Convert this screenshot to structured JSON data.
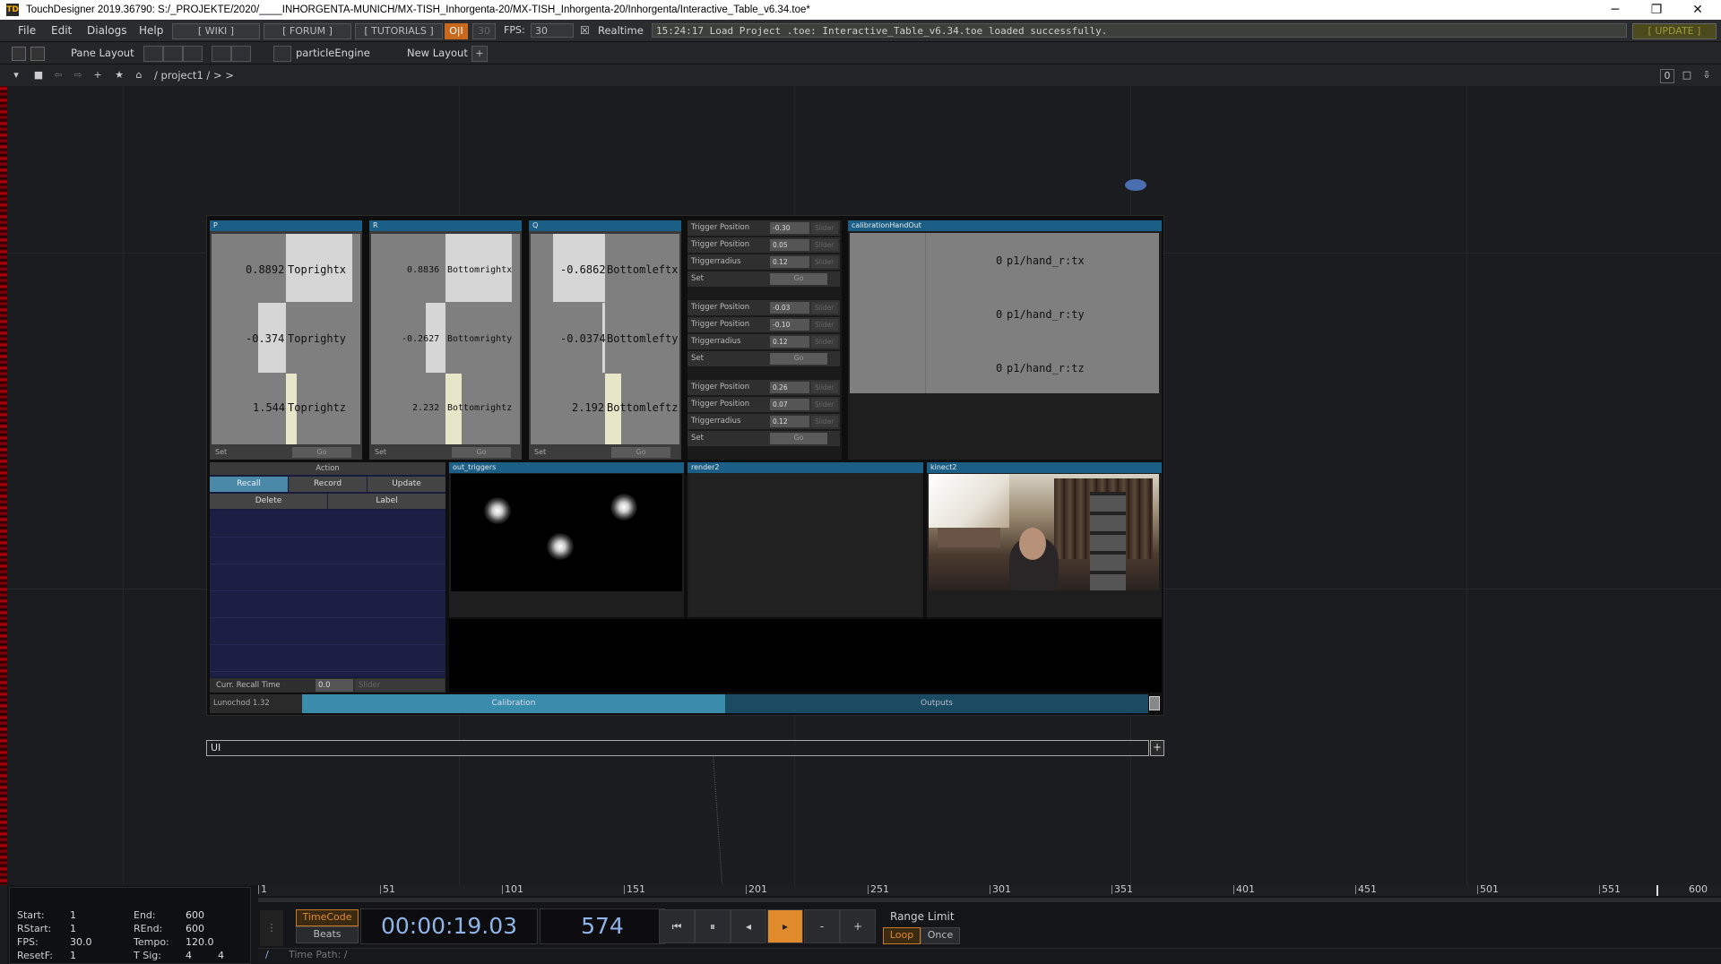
{
  "titlebar": {
    "title": "TouchDesigner 2019.36790: S:/_PROJEKTE/2020/____INHORGENTA-MUNICH/MX-TISH_Inhorgenta-20/MX-TISH_Inhorgenta-20/Inhorgenta/Interactive_Table_v6.34.toe*",
    "app_icon": "td-logo-icon",
    "minimize": "─",
    "restore": "❐",
    "close": "✕"
  },
  "menu": {
    "items": [
      "File",
      "Edit",
      "Dialogs",
      "Help"
    ],
    "wiki": "[ WIKI ]",
    "forum": "[ FORUM ]",
    "tutorials": "[ TUTORIALS ]",
    "oi": "O|I",
    "fps_box": "30",
    "fps_label": "FPS:",
    "fps_value": "30",
    "realtime_check": "☒",
    "realtime": "Realtime",
    "status": "15:24:17 Load Project .toe: Interactive_Table_v6.34.toe loaded successfully.",
    "update": "[ UPDATE ]"
  },
  "panebar": {
    "pane_layout": "Pane Layout",
    "particle": "particleEngine",
    "new_layout": "New Layout",
    "plus": "+"
  },
  "pathbar": {
    "path": "/ project1 / > >",
    "right_count": "0"
  },
  "panels": {
    "p": {
      "header": "P",
      "rows": [
        {
          "value": "0.8892",
          "name": "Toprightx",
          "fill": 0.8892
        },
        {
          "value": "-0.374",
          "name": "Toprighty",
          "fill": -0.374
        },
        {
          "value": "1.544",
          "name": "Toprightz",
          "fill": 1.544
        }
      ],
      "set": "Set",
      "go": "Go"
    },
    "r": {
      "header": "R",
      "rows": [
        {
          "value": "0.8836",
          "name": "Bottomrightx",
          "fill": 0.8836
        },
        {
          "value": "-0.2627",
          "name": "Bottomrighty",
          "fill": -0.2627
        },
        {
          "value": "2.232",
          "name": "Bottomrightz",
          "fill": 2.232
        }
      ],
      "set": "Set",
      "go": "Go"
    },
    "q": {
      "header": "Q",
      "rows": [
        {
          "value": "-0.6862",
          "name": "Bottomleftx",
          "fill": -0.6862
        },
        {
          "value": "-0.0374",
          "name": "Bottomlefty",
          "fill": -0.0374
        },
        {
          "value": "2.192",
          "name": "Bottomleftz",
          "fill": 2.192
        }
      ],
      "set": "Set",
      "go": "Go"
    }
  },
  "triggers": [
    {
      "rows": [
        {
          "label": "Trigger Position",
          "value": "-0.30",
          "slider": "Slider"
        },
        {
          "label": "Trigger Position",
          "value": "0.05",
          "slider": "Slider"
        },
        {
          "label": "Triggerradius",
          "value": "0.12",
          "slider": "Slider"
        }
      ],
      "set": "Set",
      "go": "Go"
    },
    {
      "rows": [
        {
          "label": "Trigger Position",
          "value": "-0.03",
          "slider": "Slider"
        },
        {
          "label": "Trigger Position",
          "value": "-0.10",
          "slider": "Slider"
        },
        {
          "label": "Triggerradius",
          "value": "0.12",
          "slider": "Slider"
        }
      ],
      "set": "Set",
      "go": "Go"
    },
    {
      "rows": [
        {
          "label": "Trigger Position",
          "value": "0.26",
          "slider": "Slider"
        },
        {
          "label": "Trigger Position",
          "value": "0.07",
          "slider": "Slider"
        },
        {
          "label": "Triggerradius",
          "value": "0.12",
          "slider": "Slider"
        }
      ],
      "set": "Set",
      "go": "Go"
    }
  ],
  "calibration_handout": {
    "header": "calibrationHandOut",
    "rows": [
      {
        "value": "0",
        "name": "p1/hand_r:tx"
      },
      {
        "value": "0",
        "name": "p1/hand_r:ty"
      },
      {
        "value": "0",
        "name": "p1/hand_r:tz"
      }
    ]
  },
  "action": {
    "title": "Action",
    "recall": "Recall",
    "record": "Record",
    "update": "Update",
    "delete": "Delete",
    "label": "Label",
    "curr_recall_label": "Curr. Recall Time",
    "curr_recall_value": "0.0",
    "slider": "Slider",
    "version": "Lunochod 1.32"
  },
  "views": {
    "out_triggers": "out_triggers",
    "render2": "render2",
    "kinect2": "kinect2"
  },
  "bottom_tabs": {
    "calibration": "Calibration",
    "outputs": "Outputs"
  },
  "ui_bar": {
    "label": "UI",
    "plus": "+"
  },
  "timeline": {
    "ticks": [
      "1",
      "51",
      "101",
      "151",
      "201",
      "251",
      "301",
      "351",
      "401",
      "451",
      "501",
      "551",
      "600"
    ],
    "start_label": "Start:",
    "start": "1",
    "end_label": "End:",
    "end": "600",
    "rstart_label": "RStart:",
    "rstart": "1",
    "rend_label": "REnd:",
    "rend": "600",
    "fps_label": "FPS:",
    "fps": "30.0",
    "tempo_label": "Tempo:",
    "tempo": "120.0",
    "resetf_label": "ResetF:",
    "resetf": "1",
    "tsig_label": "T Sig:",
    "tsig_a": "4",
    "tsig_b": "4",
    "timecode": "TimeCode",
    "beats": "Beats",
    "time": "00:00:19.03",
    "frame": "574",
    "range_limit": "Range Limit",
    "loop": "Loop",
    "once": "Once",
    "time_path": "Time Path: /",
    "slash": "/",
    "minus": "-",
    "plus": "+"
  },
  "colors": {
    "accent_blue": "#1b5f86",
    "orange": "#e08a2c",
    "update_olive": "#9e9b3a"
  }
}
